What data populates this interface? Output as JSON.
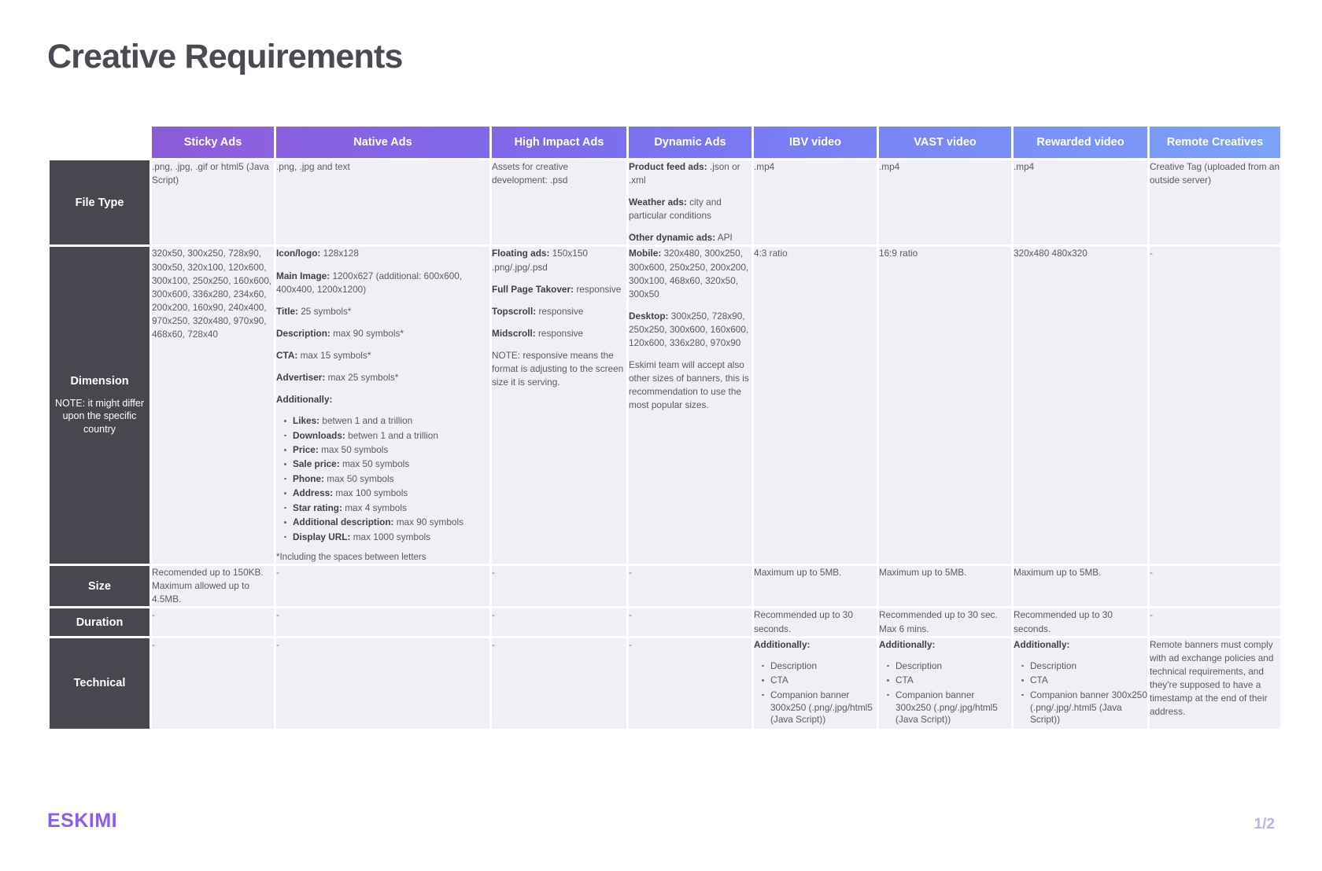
{
  "page_title": "Creative Requirements",
  "footer": {
    "logo": "ESKIMI",
    "page_number": "1/2"
  },
  "columns": [
    {
      "key": "sticky",
      "label": "Sticky Ads"
    },
    {
      "key": "native",
      "label": "Native Ads"
    },
    {
      "key": "high",
      "label": "High Impact Ads"
    },
    {
      "key": "dynamic",
      "label": "Dynamic Ads"
    },
    {
      "key": "ibv",
      "label": "IBV video"
    },
    {
      "key": "vast",
      "label": "VAST video"
    },
    {
      "key": "rewarded",
      "label": "Rewarded video"
    },
    {
      "key": "remote",
      "label": "Remote Creatives"
    }
  ],
  "rows": {
    "file_type": {
      "title": "File Type",
      "note": ""
    },
    "dimension": {
      "title": "Dimension",
      "note": "NOTE: it might differ upon the specific country"
    },
    "size": {
      "title": "Size",
      "note": ""
    },
    "duration": {
      "title": "Duration",
      "note": ""
    },
    "technical": {
      "title": "Technical",
      "note": ""
    }
  },
  "file_type": {
    "sticky": ".png, .jpg, .gif or html5 (Java Script)",
    "native": ".png, .jpg and text",
    "high": "Assets for creative development: .psd",
    "dynamic_1_label": "Product feed ads:",
    "dynamic_1_text": ".json or .xml",
    "dynamic_2_label": "Weather ads:",
    "dynamic_2_text": "city and particular conditions",
    "dynamic_3_label": "Other dynamic ads:",
    "dynamic_3_text": "API",
    "ibv": ".mp4",
    "vast": ".mp4",
    "rewarded": ".mp4",
    "remote": "Creative Tag (uploaded from an outside server)"
  },
  "dimension": {
    "sticky": "320x50, 300x250, 728x90, 300x50, 320x100, 120x600, 300x100, 250x250, 160x600, 300x600, 336x280, 234x60, 200x200, 160x90, 240x400, 970x250, 320x480, 970x90, 468x60, 728x40",
    "native": {
      "lines": [
        {
          "label": "Icon/logo:",
          "text": "128x128"
        },
        {
          "label": "Main Image:",
          "text": "1200x627 (additional: 600x600, 400x400, 1200x1200)"
        },
        {
          "label": "Title:",
          "text": "25 symbols*"
        },
        {
          "label": "Description:",
          "text": "max 90 symbols*"
        },
        {
          "label": "CTA:",
          "text": "max 15 symbols*"
        },
        {
          "label": "Advertiser:",
          "text": "max 25 symbols*"
        }
      ],
      "additionally_label": "Additionally:",
      "bullets": [
        {
          "label": "Likes:",
          "text": "betwen 1 and a trillion"
        },
        {
          "label": "Downloads:",
          "text": "betwen 1 and a trillion"
        },
        {
          "label": "Price:",
          "text": "max 50 symbols"
        },
        {
          "label": "Sale price:",
          "text": "max 50 symbols"
        },
        {
          "label": "Phone:",
          "text": "max 50 symbols"
        },
        {
          "label": "Address:",
          "text": "max 100 symbols"
        },
        {
          "label": "Star rating:",
          "text": "max 4 symbols"
        },
        {
          "label": "Additional description:",
          "text": "max 90 symbols"
        },
        {
          "label": "Display URL:",
          "text": "max 1000 symbols"
        }
      ],
      "footnote": "*Including the spaces between letters"
    },
    "high": {
      "lines": [
        {
          "label": "Floating ads:",
          "text": "150x150 .png/.jpg/.psd"
        },
        {
          "label": "Full Page Takover:",
          "text": "responsive"
        },
        {
          "label": "Topscroll:",
          "text": "responsive"
        },
        {
          "label": "Midscroll:",
          "text": "responsive"
        }
      ],
      "note": "NOTE: responsive means the format is adjusting to the screen size it is serving."
    },
    "dynamic": {
      "mobile_label": "Mobile:",
      "mobile_text": "320x480, 300x250, 300x600, 250x250, 200x200, 300x100, 468x60, 320x50, 300x50",
      "desktop_label": "Desktop:",
      "desktop_text": "300x250, 728x90, 250x250, 300x600, 160x600, 120x600, 336x280, 970x90",
      "note": "Eskimi team will accept also other sizes of banners, this is recommendation to use the most popular sizes."
    },
    "ibv": "4:3 ratio",
    "vast": "16:9 ratio",
    "rewarded": "320x480 480x320",
    "remote": "-"
  },
  "size": {
    "sticky": "Recomended up to 150KB. Maximum allowed up to 4.5MB.",
    "native": "-",
    "high": "-",
    "dynamic": "-",
    "ibv": "Maximum up to 5MB.",
    "vast": "Maximum up to 5MB.",
    "rewarded": "Maximum up to 5MB.",
    "remote": "-"
  },
  "duration": {
    "sticky": "-",
    "native": "-",
    "high": "-",
    "dynamic": "-",
    "ibv": "Recommended up to 30 seconds.",
    "vast": "Recommended up to 30 sec. Max 6 mins.",
    "rewarded": "Recommended up to 30 seconds.",
    "remote": "-"
  },
  "technical": {
    "sticky": "-",
    "native": "-",
    "high": "-",
    "dynamic": "-",
    "additionally_label": "Additionally:",
    "ibv_bullets": [
      "Description",
      "CTA",
      "Companion banner 300x250 (.png/.jpg/html5 (Java Script))"
    ],
    "vast_bullets": [
      "Description",
      "CTA",
      "Companion banner 300x250 (.png/.jpg/html5 (Java Script))"
    ],
    "rewarded_bullets": [
      "Description",
      "CTA",
      "Companion banner 300x250 (.png/.jpg/.html5 (Java Script))"
    ],
    "remote": "Remote banners must comply with ad exchange policies and technical requirements, and they're supposed to have a timestamp at the end of their address."
  }
}
